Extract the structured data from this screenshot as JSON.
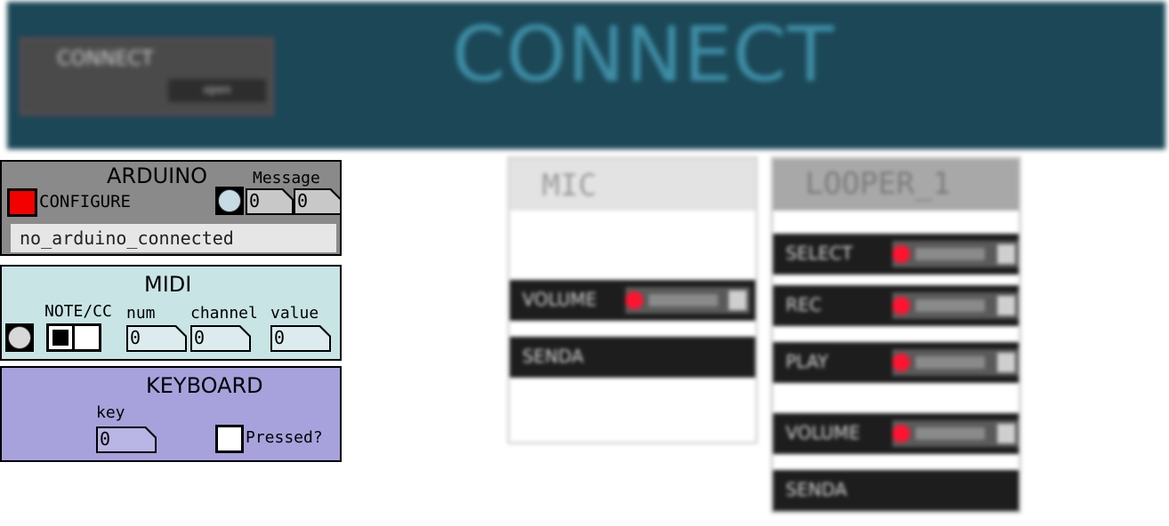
{
  "banner": {
    "title": "CONNECT",
    "box_label": "CONNECT",
    "box_button": "open"
  },
  "arduino": {
    "title": "ARDUINO",
    "configure_label": "CONFIGURE",
    "message_label": "Message",
    "message_values": [
      "0",
      "0"
    ],
    "status": "no_arduino_connected",
    "colors": {
      "panel": "#8a8a8a",
      "toggle_on": "#f30000"
    }
  },
  "midi": {
    "title": "MIDI",
    "labels": {
      "note_cc": "NOTE/CC",
      "num": "num",
      "channel": "channel",
      "value": "value"
    },
    "values": {
      "num": "0",
      "channel": "0",
      "value": "0"
    },
    "colors": {
      "panel": "#c8e4e4"
    }
  },
  "keyboard": {
    "title": "KEYBOARD",
    "key_label": "key",
    "key_value": "0",
    "pressed_label": "Pressed?",
    "colors": {
      "panel": "#a7a2dc"
    }
  },
  "mic_strip": {
    "title": "MIC",
    "rows": [
      {
        "label": "VOLUME",
        "has_slider": true
      },
      {
        "label": "SENDA",
        "has_slider": false
      }
    ]
  },
  "looper_strip": {
    "title": "LOOPER_1",
    "rows": [
      {
        "label": "SELECT",
        "has_slider": true
      },
      {
        "label": "REC",
        "has_slider": true
      },
      {
        "label": "PLAY",
        "has_slider": true
      },
      {
        "label": "VOLUME",
        "has_slider": true
      },
      {
        "label": "SENDA",
        "has_slider": false
      }
    ]
  }
}
